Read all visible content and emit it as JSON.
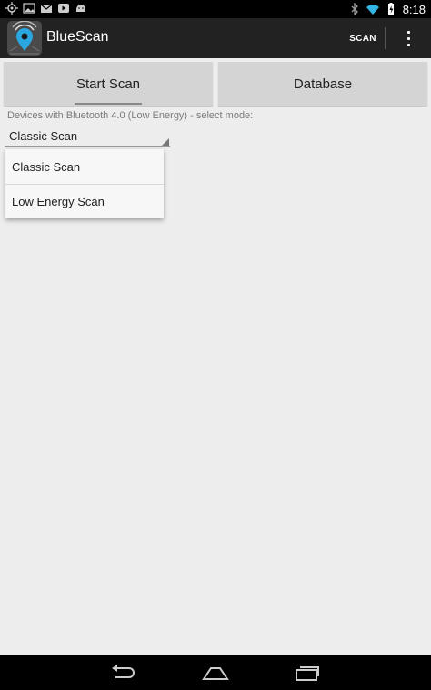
{
  "status_bar": {
    "time": "8:18",
    "left_icons": [
      "location-icon",
      "image-icon",
      "gmail-icon",
      "youtube-icon",
      "android-icon"
    ],
    "right_icons": [
      "bluetooth-icon",
      "wifi-icon",
      "battery-icon"
    ]
  },
  "action_bar": {
    "title": "BlueScan",
    "scan_label": "SCAN",
    "app_icon": "bluescan-app-icon",
    "overflow_icon": "overflow-menu-icon"
  },
  "tabs": [
    {
      "label": "Start Scan",
      "selected": true
    },
    {
      "label": "Database",
      "selected": false
    }
  ],
  "mode_hint": "Devices with Bluetooth 4.0 (Low Energy) - select mode:",
  "mode_spinner": {
    "selected": "Classic Scan",
    "options": [
      "Classic Scan",
      "Low Energy Scan"
    ]
  },
  "nav_bar": {
    "icons": [
      "back-icon",
      "home-icon",
      "recent-apps-icon"
    ]
  }
}
